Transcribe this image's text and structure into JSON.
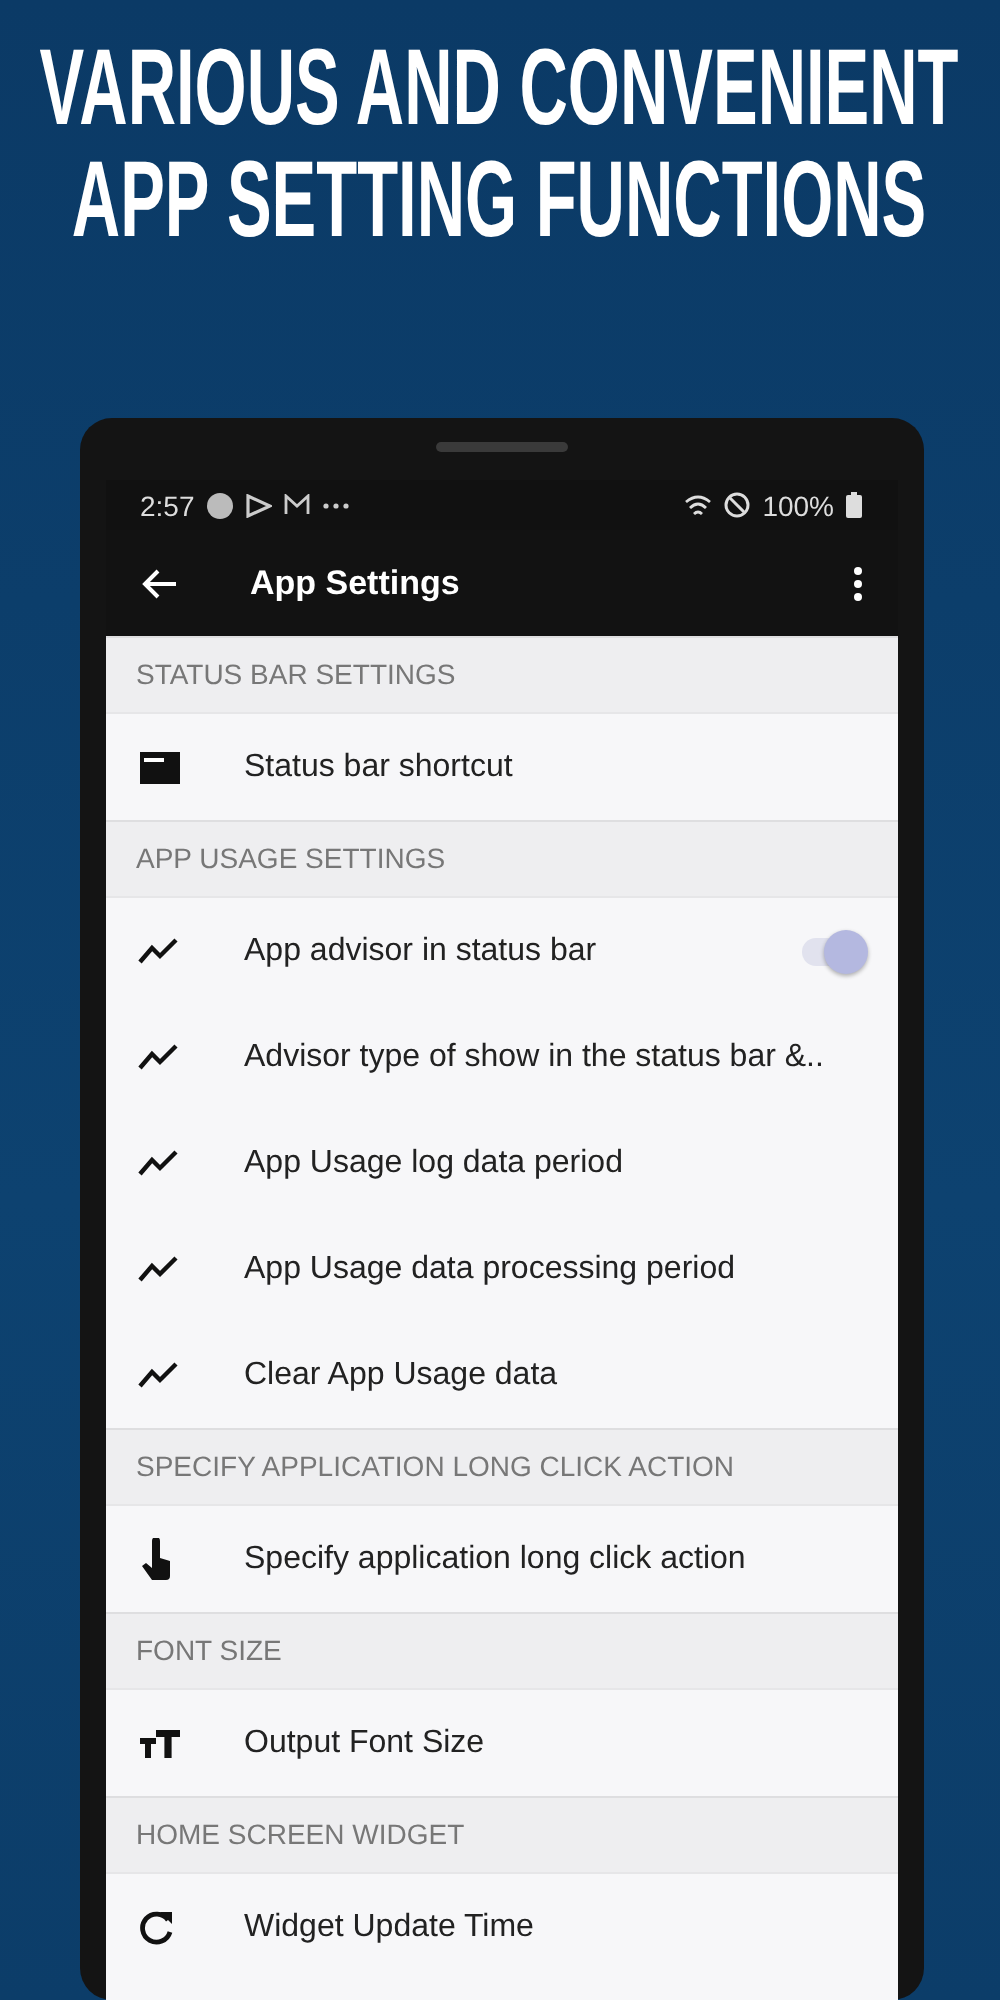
{
  "headline": [
    "VARIOUS AND CONVENIENT",
    "APP SETTING FUNCTIONS"
  ],
  "status_bar": {
    "time": "2:57",
    "battery": "100%"
  },
  "app_bar": {
    "title": "App Settings"
  },
  "sections": [
    {
      "header": "STATUS BAR SETTINGS",
      "items": [
        {
          "label": "Status bar shortcut",
          "kind": "shortcut"
        }
      ]
    },
    {
      "header": "APP USAGE SETTINGS",
      "items": [
        {
          "label": "App advisor in status bar",
          "kind": "toggle",
          "on": true
        },
        {
          "label": "Advisor type of show in the status bar &..",
          "kind": "usage"
        },
        {
          "label": "App Usage log data period",
          "kind": "usage"
        },
        {
          "label": "App Usage data processing period",
          "kind": "usage"
        },
        {
          "label": "Clear App Usage data",
          "kind": "usage"
        }
      ]
    },
    {
      "header": "SPECIFY APPLICATION LONG CLICK ACTION",
      "items": [
        {
          "label": "Specify application long click action",
          "kind": "gesture"
        }
      ]
    },
    {
      "header": "FONT SIZE",
      "items": [
        {
          "label": "Output Font Size",
          "kind": "font"
        }
      ]
    },
    {
      "header": "HOME SCREEN WIDGET",
      "items": [
        {
          "label": "Widget Update Time",
          "kind": "refresh"
        }
      ]
    }
  ]
}
